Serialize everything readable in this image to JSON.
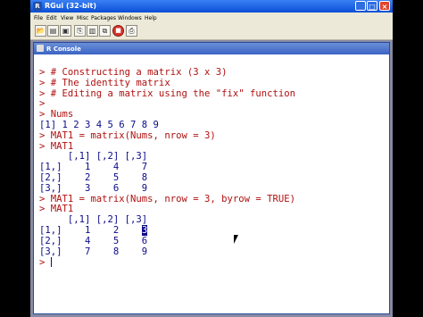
{
  "window": {
    "title": "RGui (32-bit)",
    "minimize": "_",
    "maximize": "□",
    "close": "×"
  },
  "menubar": {
    "items": [
      "File",
      "Edit",
      "View",
      "Misc",
      "Packages",
      "Windows",
      "Help"
    ]
  },
  "toolbar": {
    "buttons": [
      "open-script",
      "load-workspace",
      "save-workspace",
      "copy",
      "paste",
      "copy-paste",
      "stop",
      "print"
    ]
  },
  "console": {
    "title": "R Console",
    "lines": [
      {
        "type": "input",
        "text": "> # Constructing a matrix (3 x 3)"
      },
      {
        "type": "input",
        "text": "> # The identity matrix"
      },
      {
        "type": "input",
        "text": "> # Editing a matrix using the \"fix\" function"
      },
      {
        "type": "input",
        "text": ">"
      },
      {
        "type": "input",
        "text": "> Nums"
      },
      {
        "type": "output",
        "text": "[1] 1 2 3 4 5 6 7 8 9"
      },
      {
        "type": "input",
        "text": "> MAT1 = matrix(Nums, nrow = 3)"
      },
      {
        "type": "input",
        "text": "> MAT1"
      },
      {
        "type": "output",
        "text": "     [,1] [,2] [,3]"
      },
      {
        "type": "output",
        "text": "[1,]    1    4    7"
      },
      {
        "type": "output",
        "text": "[2,]    2    5    8"
      },
      {
        "type": "output",
        "text": "[3,]    3    6    9"
      },
      {
        "type": "input",
        "text": "> MAT1 = matrix(Nums, nrow = 3, byrow = TRUE)"
      },
      {
        "type": "input",
        "text": "> MAT1"
      },
      {
        "type": "output",
        "text": "     [,1] [,2] [,3]"
      },
      {
        "type": "output_sel",
        "before": "[1,]    1    2    ",
        "selected": "3"
      },
      {
        "type": "output",
        "text": "[2,]    4    5    6"
      },
      {
        "type": "output",
        "text": "[3,]    7    8    9"
      },
      {
        "type": "prompt",
        "text": "> "
      }
    ]
  },
  "colors": {
    "input": "#b01010",
    "output": "#0a0a8a",
    "titlebar": "#0a4fd6"
  }
}
